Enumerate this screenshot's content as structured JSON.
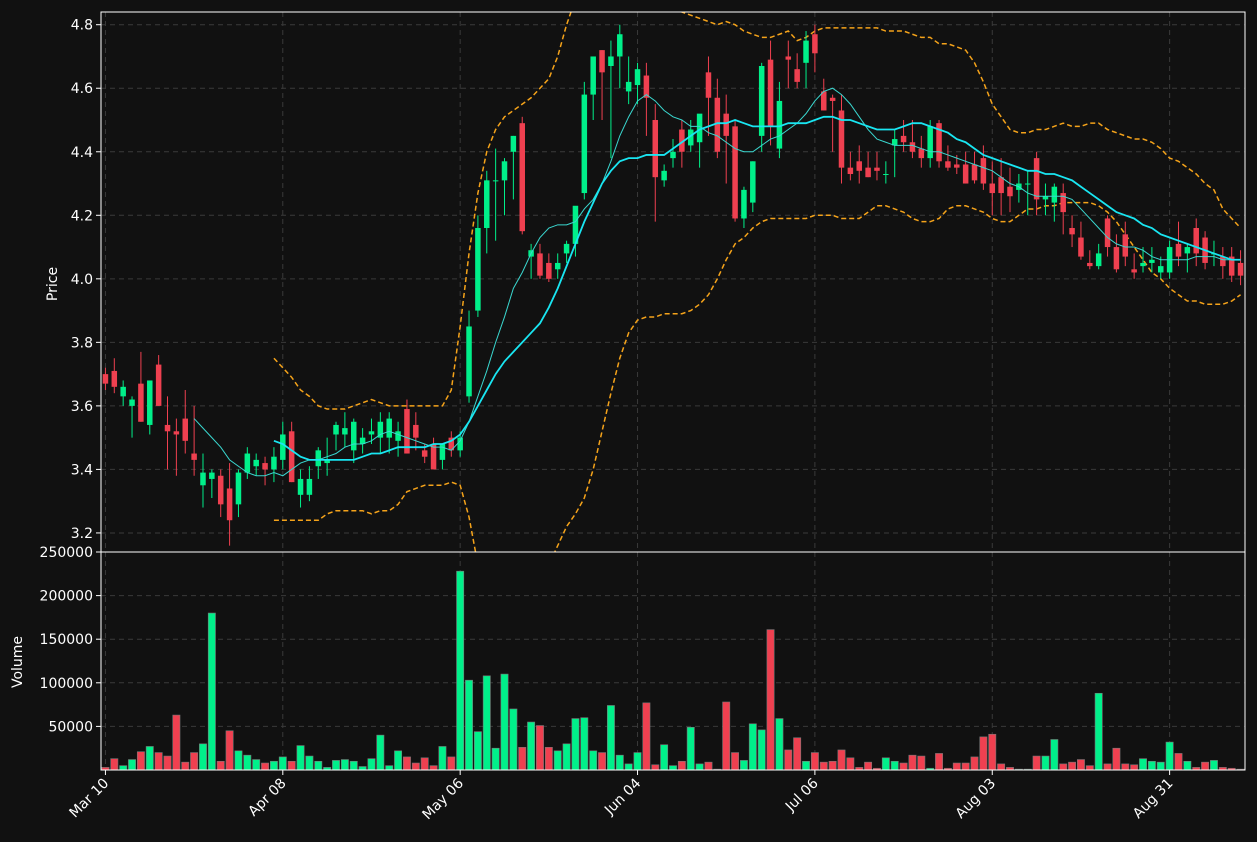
{
  "chart_data": {
    "type": "candlestick",
    "colors": {
      "background": "#111111",
      "up": "#00f08a",
      "down": "#ef4050",
      "wick_up": "#00f08a",
      "wick_down": "#ef4050",
      "ma_fast": "#3ad8d0",
      "ma_slow": "#19e6f2",
      "bollinger": "#f5a31a",
      "grid": "#3a3a3a",
      "axis": "#ffffff"
    },
    "price_axis": {
      "label": "Price",
      "ylim": [
        3.14,
        4.84
      ],
      "ticks": [
        "3.2",
        "3.4",
        "3.6",
        "3.8",
        "4.0",
        "4.2",
        "4.4",
        "4.6",
        "4.8"
      ]
    },
    "volume_axis": {
      "label": "Volume",
      "ylim": [
        0,
        250000
      ],
      "ticks": [
        "50000",
        "100000",
        "150000",
        "200000",
        "250000"
      ]
    },
    "x_axis": {
      "ticks": [
        {
          "index": 0,
          "label": "Mar 10"
        },
        {
          "index": 20,
          "label": "Apr 08"
        },
        {
          "index": 40,
          "label": "May 06"
        },
        {
          "index": 60,
          "label": "Jun 04"
        },
        {
          "index": 80,
          "label": "Jul 06"
        },
        {
          "index": 100,
          "label": "Aug 03"
        },
        {
          "index": 120,
          "label": "Aug 31"
        }
      ]
    },
    "grid": true,
    "series": [
      {
        "key": "ohlc",
        "columns": [
          "open",
          "high",
          "low",
          "close"
        ]
      },
      {
        "key": "ma_fast"
      },
      {
        "key": "ma_slow"
      },
      {
        "key": "boll_upper"
      },
      {
        "key": "boll_lower"
      },
      {
        "key": "volume"
      }
    ],
    "ohlc": [
      [
        3.7,
        3.72,
        3.65,
        3.67
      ],
      [
        3.71,
        3.75,
        3.64,
        3.66
      ],
      [
        3.63,
        3.68,
        3.6,
        3.66
      ],
      [
        3.6,
        3.63,
        3.5,
        3.62
      ],
      [
        3.67,
        3.77,
        3.55,
        3.55
      ],
      [
        3.54,
        3.68,
        3.51,
        3.68
      ],
      [
        3.73,
        3.76,
        3.6,
        3.6
      ],
      [
        3.54,
        3.63,
        3.4,
        3.52
      ],
      [
        3.52,
        3.56,
        3.38,
        3.51
      ],
      [
        3.56,
        3.65,
        3.45,
        3.49
      ],
      [
        3.45,
        3.6,
        3.38,
        3.43
      ],
      [
        3.35,
        3.45,
        3.28,
        3.39
      ],
      [
        3.37,
        3.4,
        3.31,
        3.39
      ],
      [
        3.38,
        3.4,
        3.25,
        3.29
      ],
      [
        3.34,
        3.42,
        3.16,
        3.24
      ],
      [
        3.29,
        3.4,
        3.25,
        3.39
      ],
      [
        3.39,
        3.47,
        3.37,
        3.45
      ],
      [
        3.41,
        3.45,
        3.38,
        3.43
      ],
      [
        3.42,
        3.44,
        3.35,
        3.4
      ],
      [
        3.4,
        3.47,
        3.36,
        3.44
      ],
      [
        3.43,
        3.55,
        3.4,
        3.51
      ],
      [
        3.52,
        3.55,
        3.36,
        3.36
      ],
      [
        3.32,
        3.4,
        3.28,
        3.37
      ],
      [
        3.32,
        3.41,
        3.3,
        3.37
      ],
      [
        3.41,
        3.47,
        3.37,
        3.46
      ],
      [
        3.42,
        3.5,
        3.38,
        3.43
      ],
      [
        3.51,
        3.55,
        3.46,
        3.54
      ],
      [
        3.51,
        3.58,
        3.47,
        3.53
      ],
      [
        3.46,
        3.56,
        3.42,
        3.55
      ],
      [
        3.48,
        3.53,
        3.45,
        3.5
      ],
      [
        3.51,
        3.56,
        3.48,
        3.52
      ],
      [
        3.5,
        3.58,
        3.45,
        3.55
      ],
      [
        3.5,
        3.58,
        3.45,
        3.56
      ],
      [
        3.49,
        3.55,
        3.44,
        3.52
      ],
      [
        3.59,
        3.62,
        3.45,
        3.45
      ],
      [
        3.54,
        3.58,
        3.46,
        3.5
      ],
      [
        3.46,
        3.48,
        3.42,
        3.44
      ],
      [
        3.48,
        3.5,
        3.4,
        3.4
      ],
      [
        3.43,
        3.48,
        3.4,
        3.48
      ],
      [
        3.5,
        3.52,
        3.44,
        3.46
      ],
      [
        3.46,
        3.52,
        3.44,
        3.5
      ],
      [
        3.63,
        3.9,
        3.61,
        3.85
      ],
      [
        3.9,
        4.2,
        3.88,
        4.16
      ],
      [
        4.16,
        4.34,
        4.08,
        4.31
      ],
      [
        4.31,
        4.41,
        4.12,
        4.31
      ],
      [
        4.31,
        4.38,
        4.2,
        4.37
      ],
      [
        4.4,
        4.45,
        4.25,
        4.45
      ],
      [
        4.49,
        4.51,
        4.14,
        4.15
      ],
      [
        4.07,
        4.11,
        4.0,
        4.09
      ],
      [
        4.08,
        4.11,
        4.0,
        4.01
      ],
      [
        4.05,
        4.08,
        3.99,
        4.0
      ],
      [
        4.03,
        4.08,
        4.0,
        4.05
      ],
      [
        4.08,
        4.12,
        4.05,
        4.11
      ],
      [
        4.11,
        4.2,
        4.07,
        4.23
      ],
      [
        4.27,
        4.62,
        4.25,
        4.58
      ],
      [
        4.58,
        4.7,
        4.5,
        4.7
      ],
      [
        4.72,
        4.72,
        4.5,
        4.65
      ],
      [
        4.67,
        4.75,
        4.38,
        4.7
      ],
      [
        4.7,
        4.8,
        4.6,
        4.77
      ],
      [
        4.59,
        4.7,
        4.55,
        4.62
      ],
      [
        4.61,
        4.68,
        4.55,
        4.66
      ],
      [
        4.64,
        4.68,
        4.45,
        4.57
      ],
      [
        4.5,
        4.55,
        4.18,
        4.32
      ],
      [
        4.31,
        4.36,
        4.29,
        4.34
      ],
      [
        4.38,
        4.44,
        4.35,
        4.4
      ],
      [
        4.47,
        4.5,
        4.35,
        4.4
      ],
      [
        4.42,
        4.5,
        4.4,
        4.47
      ],
      [
        4.43,
        4.5,
        4.35,
        4.52
      ],
      [
        4.65,
        4.7,
        4.45,
        4.57
      ],
      [
        4.57,
        4.63,
        4.38,
        4.4
      ],
      [
        4.52,
        4.58,
        4.3,
        4.45
      ],
      [
        4.48,
        4.5,
        4.18,
        4.19
      ],
      [
        4.19,
        4.29,
        4.16,
        4.28
      ],
      [
        4.24,
        4.37,
        4.21,
        4.37
      ],
      [
        4.45,
        4.68,
        4.4,
        4.67
      ],
      [
        4.69,
        4.75,
        4.42,
        4.48
      ],
      [
        4.41,
        4.62,
        4.38,
        4.56
      ],
      [
        4.7,
        4.75,
        4.6,
        4.69
      ],
      [
        4.66,
        4.71,
        4.6,
        4.62
      ],
      [
        4.68,
        4.78,
        4.6,
        4.75
      ],
      [
        4.77,
        4.8,
        4.65,
        4.71
      ],
      [
        4.59,
        4.63,
        4.53,
        4.53
      ],
      [
        4.57,
        4.58,
        4.4,
        4.56
      ],
      [
        4.53,
        4.58,
        4.3,
        4.35
      ],
      [
        4.35,
        4.4,
        4.31,
        4.33
      ],
      [
        4.37,
        4.42,
        4.3,
        4.34
      ],
      [
        4.35,
        4.4,
        4.32,
        4.32
      ],
      [
        4.35,
        4.4,
        4.31,
        4.34
      ],
      [
        4.33,
        4.37,
        4.3,
        4.33
      ],
      [
        4.42,
        4.47,
        4.32,
        4.44
      ],
      [
        4.45,
        4.5,
        4.4,
        4.43
      ],
      [
        4.43,
        4.5,
        4.38,
        4.4
      ],
      [
        4.41,
        4.45,
        4.35,
        4.38
      ],
      [
        4.38,
        4.5,
        4.35,
        4.48
      ],
      [
        4.49,
        4.5,
        4.35,
        4.37
      ],
      [
        4.37,
        4.42,
        4.34,
        4.35
      ],
      [
        4.36,
        4.39,
        4.33,
        4.35
      ],
      [
        4.36,
        4.4,
        4.3,
        4.3
      ],
      [
        4.36,
        4.4,
        4.3,
        4.31
      ],
      [
        4.38,
        4.42,
        4.28,
        4.3
      ],
      [
        4.3,
        4.37,
        4.2,
        4.27
      ],
      [
        4.32,
        4.38,
        4.2,
        4.27
      ],
      [
        4.29,
        4.35,
        4.21,
        4.26
      ],
      [
        4.28,
        4.33,
        4.24,
        4.3
      ],
      [
        4.3,
        4.34,
        4.2,
        4.3
      ],
      [
        4.38,
        4.4,
        4.2,
        4.25
      ],
      [
        4.25,
        4.3,
        4.2,
        4.26
      ],
      [
        4.24,
        4.3,
        4.18,
        4.29
      ],
      [
        4.27,
        4.3,
        4.14,
        4.21
      ],
      [
        4.16,
        4.2,
        4.1,
        4.14
      ],
      [
        4.13,
        4.18,
        4.06,
        4.07
      ],
      [
        4.05,
        4.09,
        4.03,
        4.04
      ],
      [
        4.04,
        4.11,
        4.03,
        4.08
      ],
      [
        4.19,
        4.2,
        4.07,
        4.1
      ],
      [
        4.1,
        4.14,
        4.02,
        4.03
      ],
      [
        4.14,
        4.18,
        4.04,
        4.07
      ],
      [
        4.03,
        4.08,
        4.0,
        4.02
      ],
      [
        4.04,
        4.1,
        4.02,
        4.05
      ],
      [
        4.05,
        4.1,
        4.02,
        4.06
      ],
      [
        4.02,
        4.07,
        4.0,
        4.04
      ],
      [
        4.02,
        4.12,
        4.0,
        4.1
      ],
      [
        4.11,
        4.18,
        4.04,
        4.07
      ],
      [
        4.08,
        4.11,
        4.02,
        4.1
      ],
      [
        4.16,
        4.19,
        4.04,
        4.08
      ],
      [
        4.13,
        4.15,
        4.03,
        4.05
      ],
      [
        4.08,
        4.12,
        4.04,
        4.08
      ],
      [
        4.07,
        4.1,
        4.0,
        4.04
      ],
      [
        4.07,
        4.1,
        3.99,
        4.01
      ],
      [
        4.05,
        4.09,
        3.98,
        4.01
      ]
    ],
    "ma_fast": [
      null,
      null,
      null,
      null,
      null,
      null,
      null,
      null,
      null,
      null,
      3.56,
      3.53,
      3.5,
      3.47,
      3.43,
      3.41,
      3.39,
      3.38,
      3.38,
      3.39,
      3.38,
      3.4,
      3.42,
      3.43,
      3.43,
      3.44,
      3.45,
      3.47,
      3.48,
      3.48,
      3.49,
      3.51,
      3.52,
      3.51,
      3.5,
      3.49,
      3.48,
      3.47,
      3.47,
      3.46,
      3.49,
      3.55,
      3.63,
      3.71,
      3.8,
      3.88,
      3.97,
      4.02,
      4.08,
      4.13,
      4.16,
      4.17,
      4.17,
      4.18,
      4.22,
      4.25,
      4.3,
      4.37,
      4.45,
      4.51,
      4.56,
      4.58,
      4.56,
      4.53,
      4.51,
      4.5,
      4.48,
      4.48,
      4.46,
      4.45,
      4.43,
      4.41,
      4.4,
      4.4,
      4.42,
      4.44,
      4.45,
      4.47,
      4.49,
      4.52,
      4.56,
      4.59,
      4.6,
      4.58,
      4.55,
      4.51,
      4.47,
      4.44,
      4.43,
      4.42,
      4.42,
      4.42,
      4.41,
      4.4,
      4.4,
      4.39,
      4.38,
      4.37,
      4.36,
      4.35,
      4.34,
      4.32,
      4.3,
      4.29,
      4.27,
      4.26,
      4.26,
      4.26,
      4.26,
      4.25,
      4.22,
      4.19,
      4.16,
      4.13,
      4.11,
      4.1,
      4.1,
      4.09,
      4.07,
      4.06,
      4.06,
      4.06,
      4.06,
      4.07,
      4.07,
      4.07,
      4.06,
      4.06,
      4.06
    ],
    "ma_slow": [
      null,
      null,
      null,
      null,
      null,
      null,
      null,
      null,
      null,
      null,
      null,
      null,
      null,
      null,
      null,
      null,
      null,
      null,
      null,
      3.49,
      3.48,
      3.46,
      3.44,
      3.43,
      3.43,
      3.43,
      3.43,
      3.43,
      3.43,
      3.44,
      3.45,
      3.45,
      3.46,
      3.47,
      3.47,
      3.47,
      3.47,
      3.48,
      3.48,
      3.49,
      3.51,
      3.55,
      3.6,
      3.65,
      3.7,
      3.74,
      3.77,
      3.8,
      3.83,
      3.86,
      3.91,
      3.97,
      4.04,
      4.11,
      4.18,
      4.24,
      4.3,
      4.34,
      4.37,
      4.38,
      4.38,
      4.39,
      4.39,
      4.39,
      4.41,
      4.43,
      4.45,
      4.47,
      4.48,
      4.49,
      4.49,
      4.5,
      4.49,
      4.48,
      4.48,
      4.48,
      4.48,
      4.49,
      4.49,
      4.49,
      4.5,
      4.51,
      4.51,
      4.5,
      4.5,
      4.49,
      4.48,
      4.47,
      4.47,
      4.47,
      4.48,
      4.49,
      4.49,
      4.48,
      4.47,
      4.46,
      4.44,
      4.43,
      4.41,
      4.39,
      4.38,
      4.37,
      4.36,
      4.35,
      4.34,
      4.34,
      4.33,
      4.33,
      4.32,
      4.31,
      4.29,
      4.27,
      4.25,
      4.23,
      4.21,
      4.2,
      4.19,
      4.17,
      4.16,
      4.14,
      4.13,
      4.12,
      4.11,
      4.1,
      4.09,
      4.08,
      4.07,
      4.06,
      4.06
    ],
    "boll_upper": [
      null,
      null,
      null,
      null,
      null,
      null,
      null,
      null,
      null,
      null,
      null,
      null,
      null,
      null,
      null,
      null,
      null,
      null,
      null,
      3.75,
      3.72,
      3.69,
      3.65,
      3.63,
      3.6,
      3.59,
      3.59,
      3.59,
      3.6,
      3.61,
      3.62,
      3.61,
      3.6,
      3.6,
      3.6,
      3.6,
      3.6,
      3.6,
      3.6,
      3.65,
      3.85,
      4.08,
      4.27,
      4.4,
      4.47,
      4.51,
      4.53,
      4.55,
      4.57,
      4.6,
      4.63,
      4.7,
      4.8,
      4.88,
      4.94,
      4.98,
      5.0,
      5.02,
      5.0,
      4.96,
      4.93,
      4.9,
      4.88,
      4.86,
      4.85,
      4.84,
      4.83,
      4.82,
      4.81,
      4.8,
      4.81,
      4.8,
      4.78,
      4.77,
      4.76,
      4.76,
      4.77,
      4.78,
      4.75,
      4.76,
      4.78,
      4.79,
      4.79,
      4.79,
      4.79,
      4.79,
      4.79,
      4.79,
      4.78,
      4.78,
      4.78,
      4.77,
      4.76,
      4.76,
      4.74,
      4.74,
      4.73,
      4.72,
      4.68,
      4.62,
      4.55,
      4.51,
      4.47,
      4.46,
      4.46,
      4.47,
      4.47,
      4.48,
      4.49,
      4.48,
      4.48,
      4.49,
      4.49,
      4.47,
      4.46,
      4.45,
      4.44,
      4.44,
      4.43,
      4.41,
      4.38,
      4.37,
      4.35,
      4.33,
      4.3,
      4.28,
      4.22,
      4.19,
      4.16
    ],
    "boll_lower": [
      null,
      null,
      null,
      null,
      null,
      null,
      null,
      null,
      null,
      null,
      null,
      null,
      null,
      null,
      null,
      null,
      null,
      null,
      null,
      3.24,
      3.24,
      3.24,
      3.24,
      3.24,
      3.24,
      3.26,
      3.27,
      3.27,
      3.27,
      3.27,
      3.26,
      3.27,
      3.27,
      3.29,
      3.33,
      3.34,
      3.35,
      3.35,
      3.35,
      3.36,
      3.35,
      3.25,
      3.1,
      2.97,
      2.9,
      2.86,
      2.88,
      2.94,
      3.0,
      3.04,
      3.1,
      3.16,
      3.22,
      3.26,
      3.31,
      3.4,
      3.52,
      3.64,
      3.75,
      3.83,
      3.87,
      3.88,
      3.88,
      3.89,
      3.89,
      3.89,
      3.9,
      3.92,
      3.95,
      4.0,
      4.06,
      4.11,
      4.13,
      4.16,
      4.18,
      4.19,
      4.19,
      4.19,
      4.19,
      4.19,
      4.2,
      4.2,
      4.2,
      4.19,
      4.19,
      4.19,
      4.21,
      4.23,
      4.23,
      4.22,
      4.21,
      4.19,
      4.18,
      4.18,
      4.19,
      4.22,
      4.23,
      4.23,
      4.22,
      4.21,
      4.19,
      4.18,
      4.18,
      4.2,
      4.22,
      4.22,
      4.23,
      4.23,
      4.24,
      4.24,
      4.24,
      4.24,
      4.23,
      4.21,
      4.18,
      4.14,
      4.1,
      4.06,
      4.02,
      4.0,
      3.97,
      3.95,
      3.93,
      3.93,
      3.92,
      3.92,
      3.92,
      3.93,
      3.95
    ],
    "volume": [
      3000,
      13000,
      5000,
      12000,
      21000,
      27000,
      20000,
      16000,
      63000,
      9000,
      20000,
      30000,
      180000,
      10000,
      45000,
      22000,
      17000,
      12000,
      8000,
      10000,
      15000,
      10000,
      28000,
      16000,
      10000,
      3000,
      11000,
      12000,
      10000,
      4000,
      13000,
      40000,
      5000,
      22000,
      15000,
      8000,
      14000,
      5000,
      27000,
      15000,
      228000,
      103000,
      44000,
      108000,
      25000,
      110000,
      70000,
      26000,
      55000,
      51000,
      26000,
      22000,
      30000,
      59000,
      60000,
      22000,
      20000,
      74000,
      17000,
      7000,
      20000,
      77000,
      6000,
      29000,
      5000,
      10000,
      49000,
      7000,
      9000,
      1000,
      78000,
      20000,
      11000,
      53000,
      46000,
      161000,
      59000,
      23000,
      37000,
      10000,
      20000,
      9000,
      10000,
      23000,
      14000,
      3000,
      9000,
      2000,
      14000,
      10000,
      8000,
      17000,
      16000,
      2000,
      19000,
      2000,
      8000,
      8000,
      15000,
      38000,
      41000,
      7000,
      3000,
      1000,
      1000,
      16000,
      16000,
      35000,
      7000,
      9000,
      12000,
      5000,
      88000,
      7000,
      25000,
      7000,
      6000,
      13000,
      10000,
      9000,
      32000,
      19000,
      10000,
      3000,
      9000,
      11000,
      3000,
      2000,
      1000
    ]
  }
}
